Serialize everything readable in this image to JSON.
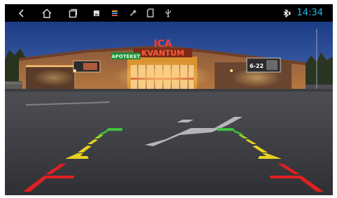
{
  "status_bar": {
    "time": "14:34",
    "icons": [
      "back-icon",
      "home-icon",
      "recent-apps-icon",
      "gallery-icon",
      "media-icon",
      "settings-icon",
      "sd-card-icon",
      "usb-icon",
      "bluetooth-icon"
    ],
    "clock_color": "#29b6e6"
  },
  "camera_view": {
    "store_logo": "ICA",
    "store_name": "KVANTUM",
    "pharmacy_sign": "APOTEKET",
    "hours_sign": "6-22",
    "guide_colors": {
      "near": "#e02020",
      "mid": "#e8d21e",
      "far": "#3fc23f"
    }
  }
}
